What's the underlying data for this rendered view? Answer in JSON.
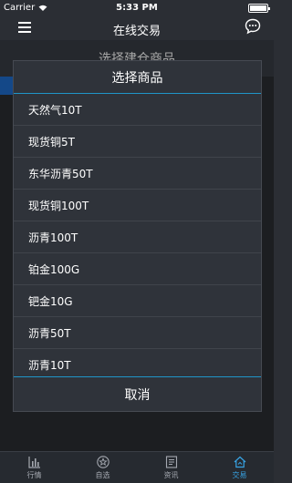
{
  "status": {
    "carrier": "Carrier",
    "time": "5:33 PM"
  },
  "navbar": {
    "title": "在线交易"
  },
  "background": {
    "subtitle": "选择建仓商品"
  },
  "modal": {
    "title": "选择商品",
    "items": [
      "天然气10T",
      "现货铜5T",
      "东华沥青50T",
      "现货铜100T",
      "沥青100T",
      "铂金100G",
      "钯金10G",
      "沥青50T",
      "沥青10T"
    ],
    "cancel": "取消"
  },
  "tabbar": {
    "tabs": [
      {
        "label": "行情",
        "icon": "chart-bar-icon"
      },
      {
        "label": "自选",
        "icon": "star-icon"
      },
      {
        "label": "资讯",
        "icon": "news-icon"
      },
      {
        "label": "交易",
        "icon": "trade-home-icon",
        "active": true
      }
    ]
  },
  "colors": {
    "accent": "#1f95c8",
    "active_tab": "#37a3e3"
  }
}
